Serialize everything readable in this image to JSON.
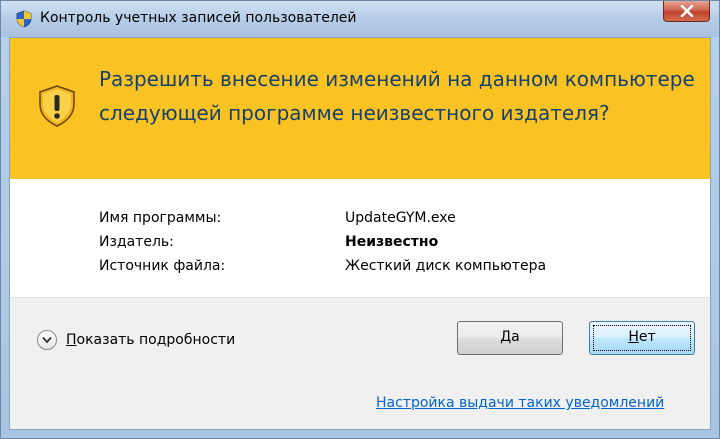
{
  "window": {
    "title": "Контроль учетных записей пользователей"
  },
  "banner": {
    "question": "Разрешить внесение изменений на данном компьютере следующей программе неизвестного издателя?"
  },
  "details": [
    {
      "label": "Имя программы:",
      "value": "UpdateGYM.exe",
      "bold": false
    },
    {
      "label": "Издатель:",
      "value": "Неизвестно",
      "bold": true
    },
    {
      "label": "Источник файла:",
      "value": "Жесткий диск компьютера",
      "bold": false
    }
  ],
  "footer": {
    "show_details_access": "П",
    "show_details_rest": "оказать подробности",
    "yes_access": "Д",
    "yes_rest": "а",
    "no_access": "Н",
    "no_rest": "ет",
    "settings_link": "Настройка выдачи таких уведомлений"
  },
  "colors": {
    "banner": "#fbc223",
    "banner_text": "#15416e",
    "link": "#0066cc",
    "close_button": "#c0432c"
  },
  "icons": [
    "uac-shield-icon",
    "close-icon",
    "warning-shield-icon",
    "chevron-down-icon"
  ]
}
